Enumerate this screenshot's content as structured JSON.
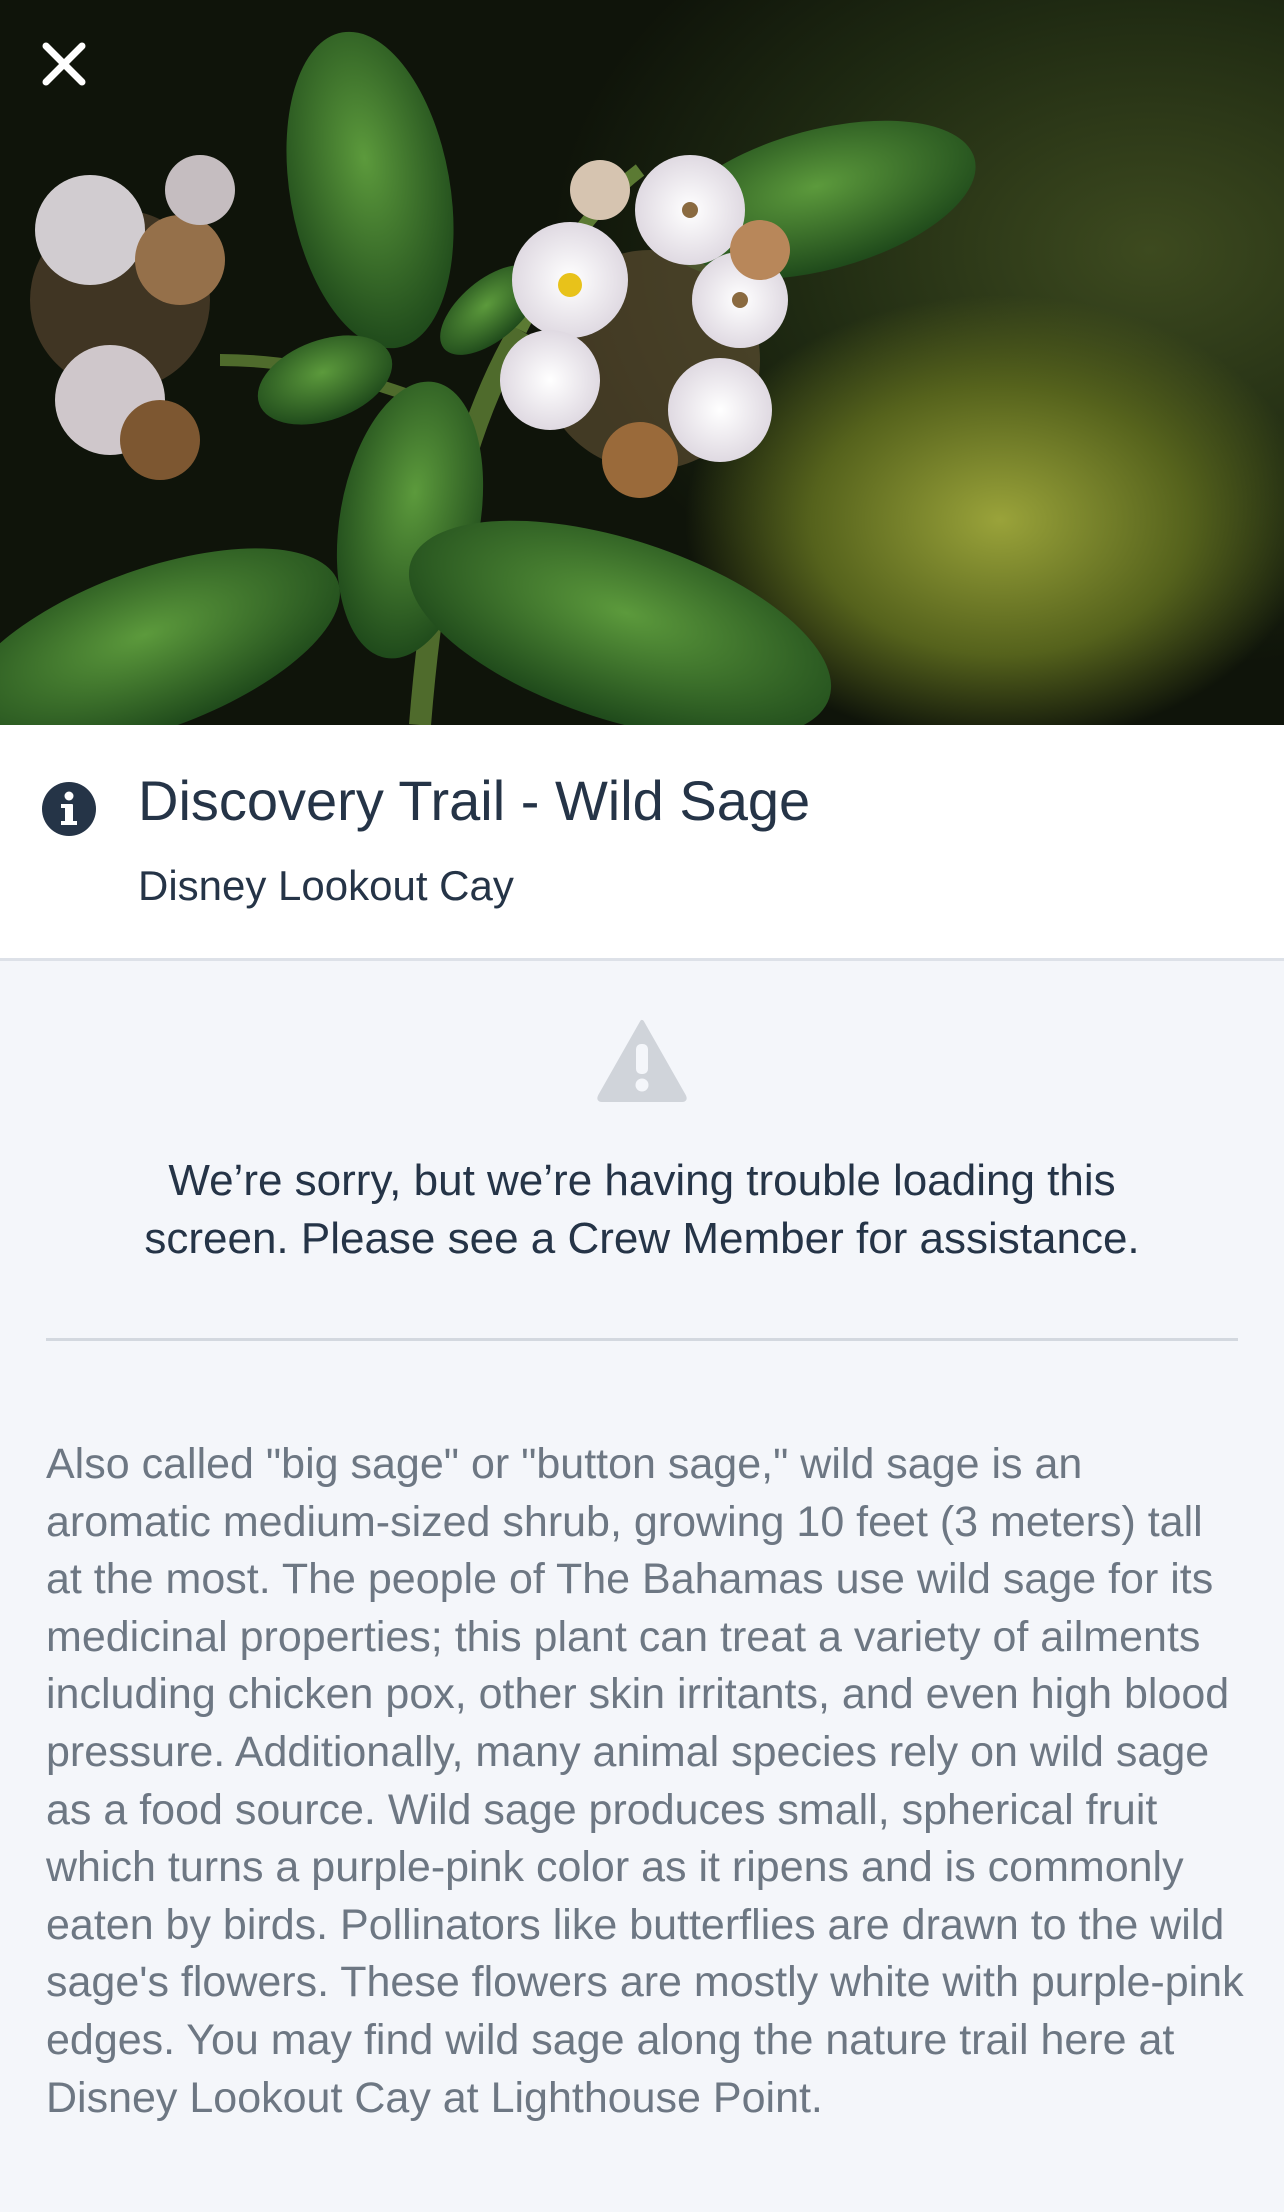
{
  "hero": {
    "image_alt": "Close-up photo of wild sage with white flowers and green leaves",
    "close_icon": "close-icon"
  },
  "header": {
    "info_icon": "info-icon",
    "title": "Discovery Trail - Wild Sage",
    "subtitle": "Disney Lookout Cay"
  },
  "error": {
    "icon": "warning-icon",
    "message": "We’re sorry, but we’re having trouble loading this screen. Please see a Crew Member for assistance."
  },
  "description": "Also called \"big sage\" or \"button sage,\" wild sage is an aromatic medium-sized shrub, growing 10 feet (3 meters) tall at the most. The people of The Bahamas use wild sage for its medicinal properties; this plant can treat a variety of ailments including chicken pox, other skin irritants, and even high blood pressure. Additionally, many animal species rely on wild sage as a food source. Wild sage produces small, spherical fruit which turns a purple-pink color as it ripens and is commonly eaten by birds. Pollinators like butterflies are drawn to the wild sage's flowers. These flowers are mostly white with purple-pink edges. You may find wild sage along the nature trail here at Disney Lookout Cay at Lighthouse Point.",
  "colors": {
    "text_primary": "#253447",
    "text_secondary": "#6d7783",
    "background": "#f4f6fa",
    "icon_gray": "#d0d4da"
  }
}
